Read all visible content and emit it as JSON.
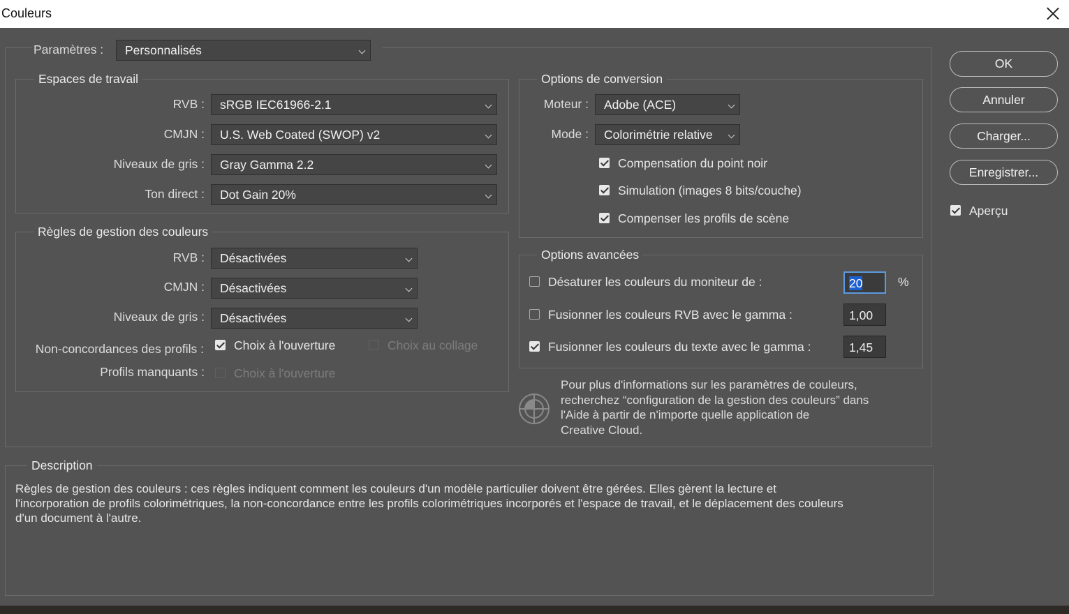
{
  "window": {
    "title": "Couleurs"
  },
  "parametres": {
    "label": "Paramètres :",
    "value": "Personnalisés"
  },
  "espaces": {
    "legend": "Espaces de travail",
    "rows": [
      {
        "label": "RVB :",
        "value": "sRGB IEC61966-2.1"
      },
      {
        "label": "CMJN :",
        "value": "U.S. Web Coated (SWOP) v2"
      },
      {
        "label": "Niveaux de gris :",
        "value": "Gray Gamma 2.2"
      },
      {
        "label": "Ton direct :",
        "value": "Dot Gain 20%"
      }
    ]
  },
  "regles": {
    "legend": "Règles de gestion des couleurs",
    "rows": [
      {
        "label": "RVB :",
        "value": "Désactivées"
      },
      {
        "label": "CMJN :",
        "value": "Désactivées"
      },
      {
        "label": "Niveaux de gris :",
        "value": "Désactivées"
      }
    ],
    "mismatch_label": "Non-concordances des profils :",
    "mismatch_open": {
      "label": "Choix à l'ouverture",
      "checked": true
    },
    "mismatch_paste": {
      "label": "Choix au collage",
      "checked": false,
      "disabled": true
    },
    "missing_label": "Profils manquants :",
    "missing_open": {
      "label": "Choix à l'ouverture",
      "checked": false,
      "disabled": true
    }
  },
  "conversion": {
    "legend": "Options de conversion",
    "engine_label": "Moteur :",
    "engine_value": "Adobe (ACE)",
    "mode_label": "Mode :",
    "mode_value": "Colorimétrie relative",
    "checkboxes": [
      {
        "label": "Compensation du point noir",
        "checked": true
      },
      {
        "label": "Simulation (images 8 bits/couche)",
        "checked": true
      },
      {
        "label": "Compenser les profils de scène",
        "checked": true
      }
    ]
  },
  "avancees": {
    "legend": "Options avancées",
    "desaturate": {
      "label": "Désaturer les couleurs du moniteur de :",
      "checked": false,
      "value": "20",
      "unit": "%"
    },
    "blend_rgb": {
      "label": "Fusionner les couleurs RVB avec le gamma :",
      "checked": false,
      "value": "1,00"
    },
    "blend_text": {
      "label": "Fusionner les couleurs du texte avec le gamma :",
      "checked": true,
      "value": "1,45"
    }
  },
  "info": {
    "lines": [
      "Pour plus d'informations sur les paramètres de couleurs,",
      "recherchez “configuration de la gestion des couleurs” dans",
      "l'Aide à partir de n'importe quelle application de",
      "Creative Cloud."
    ]
  },
  "description": {
    "legend": "Description",
    "lines": [
      "Règles de gestion des couleurs : ces règles indiquent comment les couleurs d'un modèle particulier doivent être gérées. Elles gèrent la lecture et",
      "l'incorporation de profils colorimétriques, la non-concordance entre les profils colorimétriques incorporés et l'espace de travail, et le déplacement des couleurs",
      "d'un document à l'autre."
    ]
  },
  "buttons": {
    "ok": "OK",
    "cancel": "Annuler",
    "load": "Charger...",
    "save": "Enregistrer..."
  },
  "preview": {
    "label": "Aperçu",
    "checked": true
  },
  "colors": {
    "background": "#535353",
    "titlebar": "#ffffff",
    "focus": "#5b9ae0",
    "selection": "#1c5fd0"
  }
}
